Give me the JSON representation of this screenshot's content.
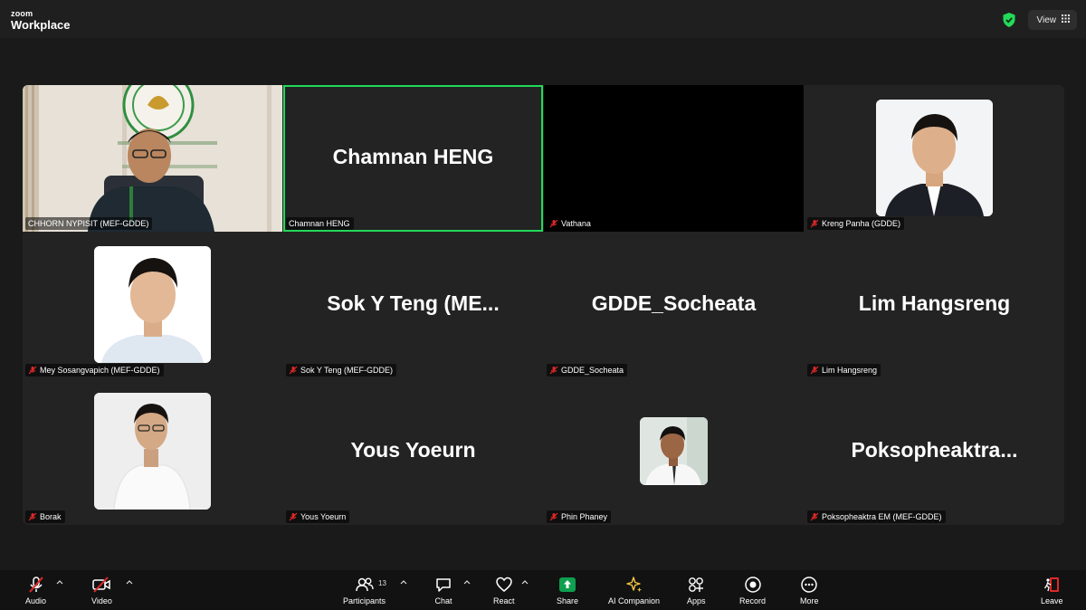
{
  "app": {
    "brand_top": "zoom",
    "brand_bottom": "Workplace"
  },
  "topbar": {
    "view_label": "View",
    "encryption_color": "#23d959"
  },
  "tiles": [
    {
      "name": "CHHORN NYPISIT (MEF-GDDE)",
      "type": "video",
      "muted": false
    },
    {
      "name": "Chamnan HENG",
      "display": "Chamnan HENG",
      "type": "text",
      "muted": false,
      "active_speaker": true
    },
    {
      "name": "Vathana",
      "type": "black",
      "muted": true
    },
    {
      "name": "Kreng Panha (GDDE)",
      "type": "photo",
      "muted": true
    },
    {
      "name": "Mey Sosangvapich (MEF-GDDE)",
      "type": "photo",
      "muted": true
    },
    {
      "name": "Sok Y Teng (MEF-GDDE)",
      "display": "Sok Y Teng (ME...",
      "type": "text",
      "muted": true
    },
    {
      "name": "GDDE_Socheata",
      "display": "GDDE_Socheata",
      "type": "text",
      "muted": true
    },
    {
      "name": "Lim Hangsreng",
      "display": "Lim Hangsreng",
      "type": "text",
      "muted": true
    },
    {
      "name": "Borak",
      "type": "photo",
      "muted": true
    },
    {
      "name": "Yous Yoeurn",
      "display": "Yous Yoeurn",
      "type": "text",
      "muted": true
    },
    {
      "name": "Phin Phaney",
      "type": "photo-small",
      "muted": true
    },
    {
      "name": "Poksopheaktra EM (MEF-GDDE)",
      "display": "Poksopheaktra...",
      "type": "text",
      "muted": true
    }
  ],
  "toolbar": {
    "audio": "Audio",
    "video": "Video",
    "participants": "Participants",
    "participants_count": "13",
    "chat": "Chat",
    "react": "React",
    "share": "Share",
    "ai_companion": "AI Companion",
    "apps": "Apps",
    "record": "Record",
    "more": "More",
    "leave": "Leave",
    "share_color": "#0e9f4f",
    "leave_color": "#e02828"
  }
}
